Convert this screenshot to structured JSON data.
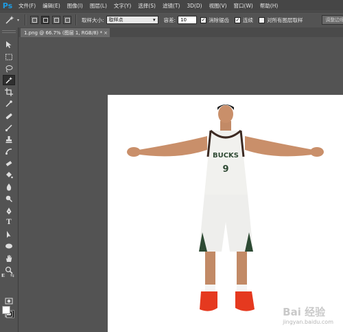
{
  "app": {
    "logo": "Ps"
  },
  "menu": [
    "文件(F)",
    "编辑(E)",
    "图像(I)",
    "图层(L)",
    "文字(Y)",
    "选择(S)",
    "滤镜(T)",
    "3D(D)",
    "视图(V)",
    "窗口(W)",
    "帮助(H)"
  ],
  "options": {
    "sample_size_label": "取样大小:",
    "sample_size_value": "取样点",
    "tolerance_label": "容差:",
    "tolerance_value": "10",
    "antialias_label": "消除锯齿",
    "antialias_checked": true,
    "contiguous_label": "连续",
    "contiguous_checked": true,
    "sample_all_label": "对所有图层取样",
    "sample_all_checked": false,
    "refine_edge_label": "调整边缘..."
  },
  "document": {
    "tab_title": "1.png @ 66.7% (图层 1, RGB/8) *",
    "close_glyph": "×"
  },
  "tools": [
    "move-icon",
    "marquee-icon",
    "lasso-icon",
    "magic-wand-icon",
    "crop-icon",
    "eyedropper-icon",
    "healing-brush-icon",
    "brush-icon",
    "clone-stamp-icon",
    "history-brush-icon",
    "eraser-icon",
    "paint-bucket-icon",
    "blur-icon",
    "dodge-icon",
    "pen-icon",
    "type-icon",
    "path-select-icon",
    "shape-icon",
    "hand-icon",
    "zoom-icon"
  ],
  "colors": {
    "foreground": "#ffffff",
    "background": "#000000",
    "accent": "#1e9be2",
    "ui_bg": "#535353"
  },
  "player": {
    "team": "BUCKS",
    "number": "9"
  },
  "watermark": {
    "brand": "Bai 经验",
    "url": "jingyan.baidu.com"
  }
}
